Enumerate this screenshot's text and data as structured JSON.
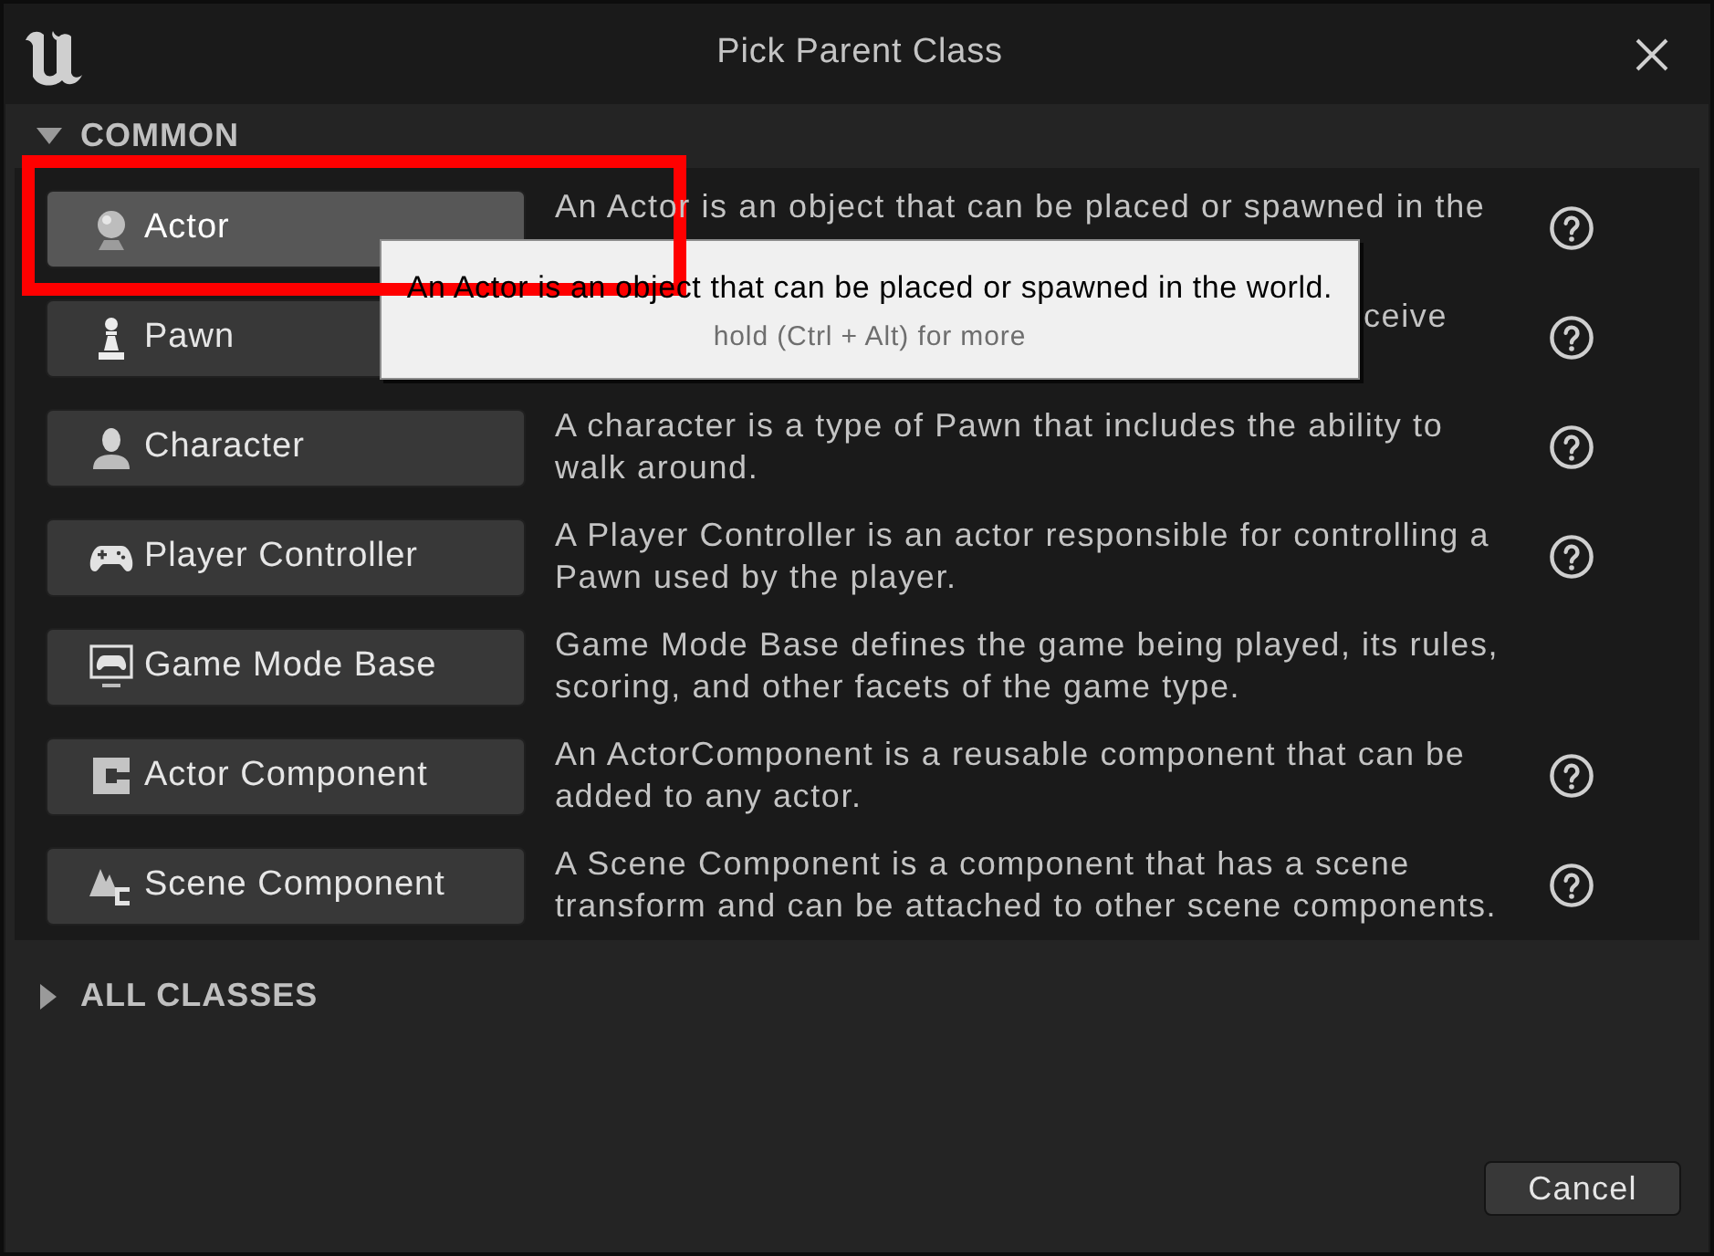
{
  "window": {
    "title": "Pick Parent Class"
  },
  "sections": [
    {
      "label": "COMMON",
      "expanded": true,
      "classes": [
        {
          "kind": "actor",
          "label": "Actor",
          "hovered": true,
          "description": "An Actor is an object that can be placed or spawned in the",
          "help": true
        },
        {
          "kind": "pawn",
          "label": "Pawn",
          "hovered": false,
          "description": "ceive",
          "help": true
        },
        {
          "kind": "character",
          "label": "Character",
          "hovered": false,
          "description": "A character is a type of Pawn that includes the ability to walk around.",
          "help": true
        },
        {
          "kind": "player_controller",
          "label": "Player Controller",
          "hovered": false,
          "description": "A Player Controller is an actor responsible for controlling a Pawn used by the player.",
          "help": true
        },
        {
          "kind": "game_mode_base",
          "label": "Game Mode Base",
          "hovered": false,
          "description": "Game Mode Base defines the game being played, its rules, scoring, and other facets of the game type.",
          "help": false
        },
        {
          "kind": "actor_component",
          "label": "Actor Component",
          "hovered": false,
          "description": "An ActorComponent is a reusable component that can be added to any actor.",
          "help": true
        },
        {
          "kind": "scene_component",
          "label": "Scene Component",
          "hovered": false,
          "description": "A Scene Component is a component that has a scene transform and can be attached to other scene components.",
          "help": true
        }
      ]
    },
    {
      "label": "ALL CLASSES",
      "expanded": false
    }
  ],
  "tooltip": {
    "text": "An Actor is an object that can be placed or spawned in the world.",
    "hint": "hold (Ctrl + Alt) for more"
  },
  "buttons": [
    {
      "label": "Cancel"
    }
  ]
}
